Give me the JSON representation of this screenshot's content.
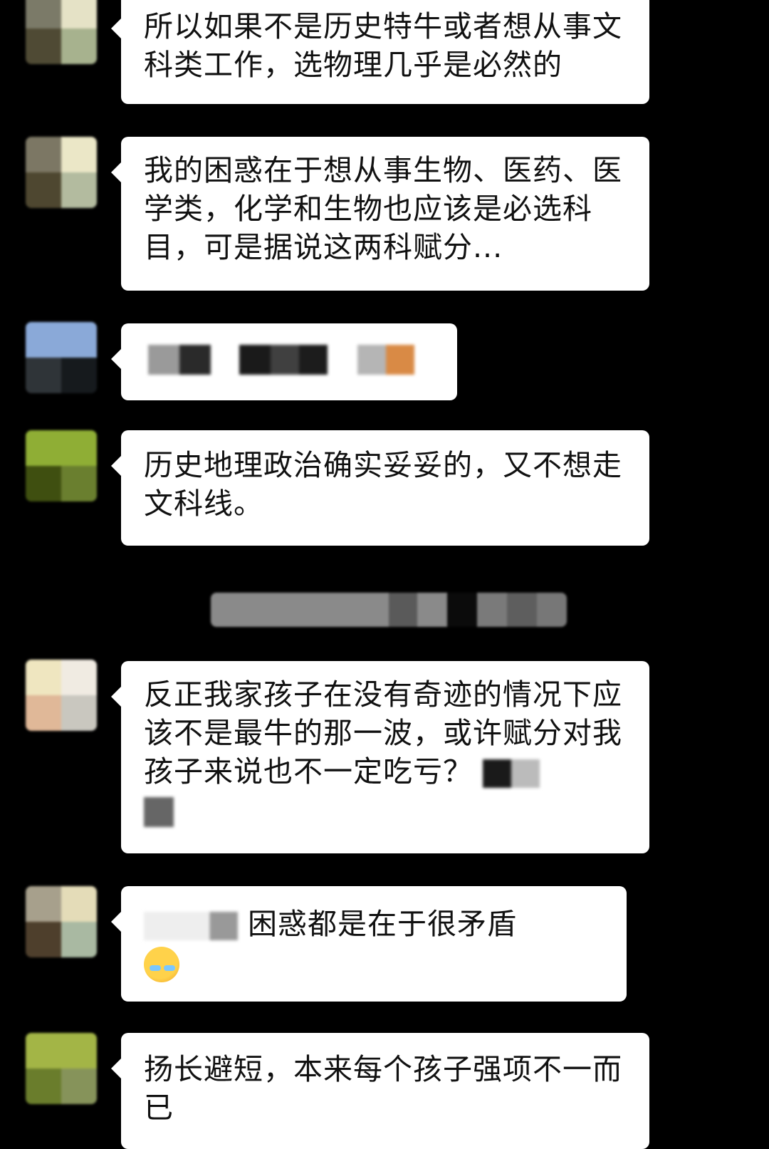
{
  "messages": [
    {
      "text": "所以如果不是历史特牛或者想从事文科类工作，选物理几乎是必然的"
    },
    {
      "text": "我的困惑在于想从事生物、医药、医学类，化学和生物也应该是必选科目，可是据说这两科赋分..."
    },
    {
      "text": ""
    },
    {
      "text": "历史地理政治确实妥妥的，又不想走文科线。"
    },
    {
      "text": "反正我家孩子在没有奇迹的情况下应该不是最牛的那一波，或许赋分对我孩子来说也不一定吃亏？"
    },
    {
      "text": "困惑都是在于很矛盾"
    },
    {
      "text": "扬长避短，本来每个孩子强项不一而已"
    }
  ],
  "icons": {
    "emoji": "face-with-tears-of-joy-icon"
  },
  "colors": {
    "background": "#000000",
    "bubble": "#ffffff",
    "text": "#111111"
  }
}
